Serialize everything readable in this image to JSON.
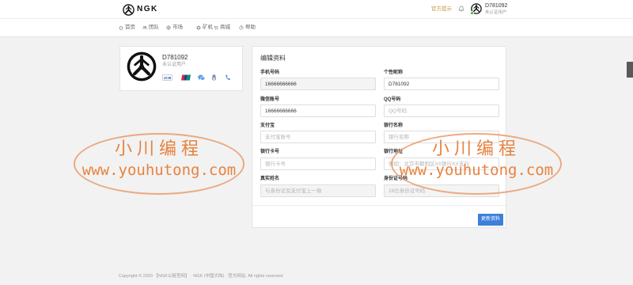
{
  "colors": {
    "accent": "#3d7fd9",
    "notice": "#c8963e",
    "online": "#2fbf4a",
    "watermark": "#e6762a"
  },
  "header": {
    "brand": "NGK",
    "logo_icon": "ngk-logo-icon",
    "notice_label": "官方提示",
    "bell_icon": "bell-icon",
    "user": {
      "name": "D781092",
      "status": "未认证用户"
    }
  },
  "nav": {
    "items": [
      {
        "label": "首页",
        "icon": "home-icon"
      },
      {
        "label": "团队",
        "icon": "users-icon"
      },
      {
        "label": "市场",
        "icon": "globe-icon"
      },
      {
        "label": "矿机",
        "icon": "gear-icon"
      },
      {
        "label": "商城",
        "icon": "cart-icon"
      },
      {
        "label": "帮助",
        "icon": "help-icon"
      }
    ]
  },
  "profile_card": {
    "name": "D781092",
    "status": "未认证用户",
    "badges": [
      {
        "icon": "jcb-card-icon",
        "label": "JCB"
      },
      {
        "icon": "unionpay-icon"
      },
      {
        "icon": "wechat-icon"
      },
      {
        "icon": "qq-icon"
      },
      {
        "icon": "phone-icon"
      }
    ]
  },
  "edit_form": {
    "title": "编辑资料",
    "fields": [
      {
        "label": "手机号码",
        "value": "16666666666",
        "readonly": true
      },
      {
        "label": "个性昵称",
        "value": "D781092"
      },
      {
        "label": "微信账号",
        "value": "16666666666"
      },
      {
        "label": "QQ号码",
        "placeholder": "QQ号码"
      },
      {
        "label": "支付宝",
        "placeholder": "支付宝账号"
      },
      {
        "label": "银行名称",
        "placeholder": "银行名称"
      },
      {
        "label": "银行卡号",
        "placeholder": "银行卡号"
      },
      {
        "label": "银行地址",
        "placeholder": "例如：北京市朝阳区XX银行XX支行"
      },
      {
        "label": "真实姓名",
        "placeholder": "与身份证及支付宝上一致",
        "readonly": true
      },
      {
        "label": "身份证号码",
        "placeholder": "18位身份证号码",
        "readonly": true
      }
    ],
    "submit_label": "更新资料"
  },
  "footer": {
    "copyright": "Copyright © 2020 【NGK公链官网】 · NGK (中国大陆) · 官方网站. All rights reserved."
  },
  "watermark": {
    "title": "小川编程",
    "url": "www.youhutong.com"
  }
}
